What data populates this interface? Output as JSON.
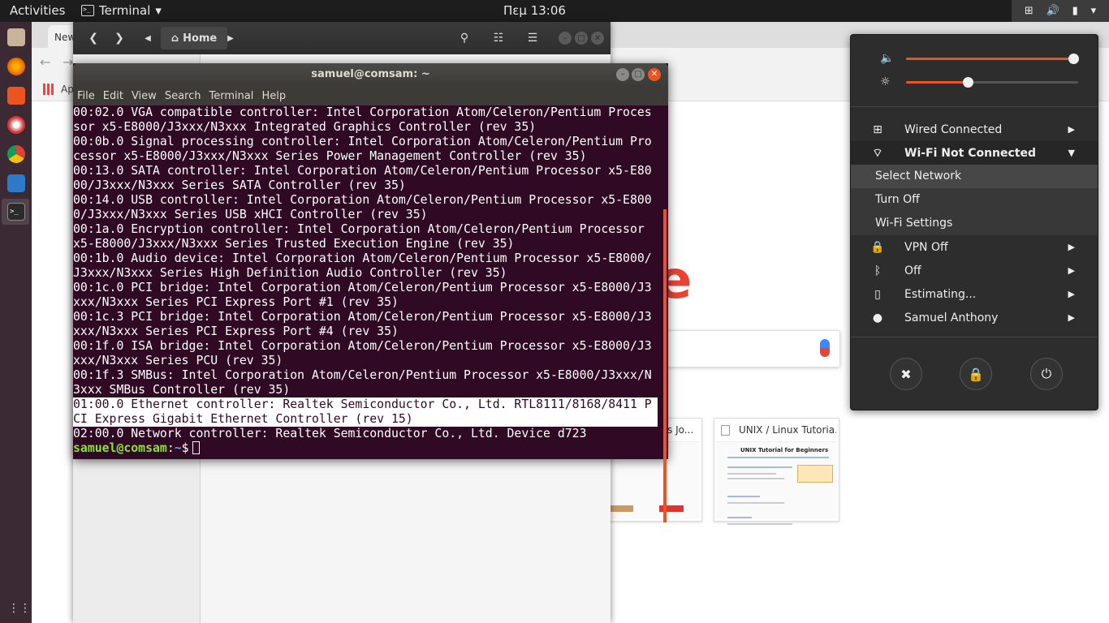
{
  "topbar": {
    "activities": "Activities",
    "app_name": "Terminal",
    "app_arrow": "▾",
    "clock": "Πεμ 13:06",
    "tray_icons": [
      "network-icon",
      "volume-icon",
      "battery-icon",
      "dropdown-icon"
    ]
  },
  "dock": {
    "apps": [
      "files-icon",
      "firefox-icon",
      "software-center-icon",
      "settings-icon",
      "chrome-icon",
      "vscode-icon",
      "terminal-icon"
    ],
    "show_apps": "⋮⋮⋮"
  },
  "chrome": {
    "tab_title": "New",
    "bookmarks_apps": "Ap",
    "logo_fragment": "e",
    "thumbnails": [
      {
        "title": "s Jo..."
      },
      {
        "title": "UNIX / Linux Tutoria...",
        "preview_heading": "UNIX Tutorial for Beginners"
      }
    ]
  },
  "nautilus": {
    "location": "Home"
  },
  "terminal": {
    "title": "samuel@comsam: ~",
    "menu": [
      "File",
      "Edit",
      "View",
      "Search",
      "Terminal",
      "Help"
    ],
    "lines": [
      "00:02.0 VGA compatible controller: Intel Corporation Atom/Celeron/Pentium Proces",
      "sor x5-E8000/J3xxx/N3xxx Integrated Graphics Controller (rev 35)",
      "00:0b.0 Signal processing controller: Intel Corporation Atom/Celeron/Pentium Pro",
      "cessor x5-E8000/J3xxx/N3xxx Series Power Management Controller (rev 35)",
      "00:13.0 SATA controller: Intel Corporation Atom/Celeron/Pentium Processor x5-E80",
      "00/J3xxx/N3xxx Series SATA Controller (rev 35)",
      "00:14.0 USB controller: Intel Corporation Atom/Celeron/Pentium Processor x5-E800",
      "0/J3xxx/N3xxx Series USB xHCI Controller (rev 35)",
      "00:1a.0 Encryption controller: Intel Corporation Atom/Celeron/Pentium Processor",
      "x5-E8000/J3xxx/N3xxx Series Trusted Execution Engine (rev 35)",
      "00:1b.0 Audio device: Intel Corporation Atom/Celeron/Pentium Processor x5-E8000/",
      "J3xxx/N3xxx Series High Definition Audio Controller (rev 35)",
      "00:1c.0 PCI bridge: Intel Corporation Atom/Celeron/Pentium Processor x5-E8000/J3",
      "xxx/N3xxx Series PCI Express Port #1 (rev 35)",
      "00:1c.3 PCI bridge: Intel Corporation Atom/Celeron/Pentium Processor x5-E8000/J3",
      "xxx/N3xxx Series PCI Express Port #4 (rev 35)",
      "00:1f.0 ISA bridge: Intel Corporation Atom/Celeron/Pentium Processor x5-E8000/J3",
      "xxx/N3xxx Series PCU (rev 35)",
      "00:1f.3 SMBus: Intel Corporation Atom/Celeron/Pentium Processor x5-E8000/J3xxx/N",
      "3xxx SMBus Controller (rev 35)",
      "01:00.0 Ethernet controller: Realtek Semiconductor Co., Ltd. RTL8111/8168/8411 P",
      "CI Express Gigabit Ethernet Controller (rev 15)",
      "02:00.0 Network controller: Realtek Semiconductor Co., Ltd. Device d723"
    ],
    "selected_lines": [
      20,
      21
    ],
    "prompt_user": "samuel@comsam",
    "prompt_sep": ":",
    "prompt_path": "~",
    "prompt_symbol": "$"
  },
  "system_menu": {
    "volume_level": 0.97,
    "brightness_level": 0.36,
    "wired": "Wired Connected",
    "wifi": "Wi-Fi Not Connected",
    "wifi_submenu": [
      "Select Network",
      "Turn Off",
      "Wi-Fi Settings"
    ],
    "vpn": "VPN Off",
    "bluetooth": "Off",
    "battery": "Estimating...",
    "user": "Samuel Anthony",
    "accent": "#e95420"
  }
}
